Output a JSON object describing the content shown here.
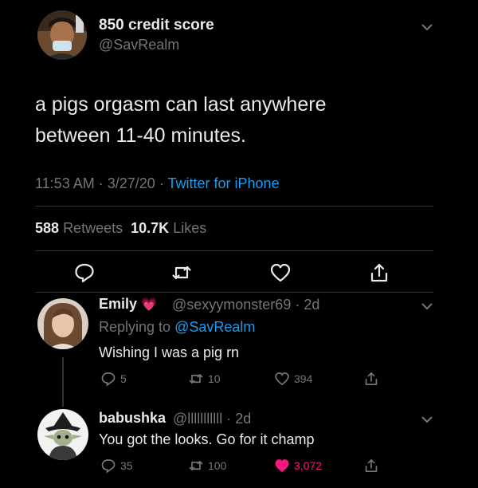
{
  "tweet": {
    "author_name": "850 credit score",
    "author_handle": "@SavRealm",
    "text_line1": "a pigs orgasm can last anywhere",
    "text_line2": "between 11-40 minutes.",
    "time": "11:53 AM",
    "date": "3/27/20",
    "sep": "·",
    "source": "Twitter for iPhone",
    "retweets_count": "588",
    "retweets_label": "Retweets",
    "likes_count": "10.7K",
    "likes_label": "Likes"
  },
  "replies": [
    {
      "name": "Emily",
      "emoji": "💗",
      "handle": "@sexyymonster69 · 2d",
      "replying_prefix": "Replying to",
      "replying_to": "@SavRealm",
      "text": "Wishing I was a pig rn",
      "reply_count": "5",
      "retweet_count": "10",
      "like_count": "394"
    },
    {
      "name": "babushka",
      "handle": "@lllllllllll · 2d",
      "text": "You got the looks. Go for it champ",
      "reply_count": "35",
      "retweet_count": "100",
      "like_count": "3,072"
    }
  ],
  "icons": {
    "reply": "reply-icon",
    "retweet": "retweet-icon",
    "like": "heart-icon",
    "share": "share-icon",
    "more": "chevron-down-icon"
  },
  "colors": {
    "background": "#000000",
    "text": "#e7e9ea",
    "muted": "#71767b",
    "link": "#1d9bf0",
    "like_active": "#f91880"
  }
}
